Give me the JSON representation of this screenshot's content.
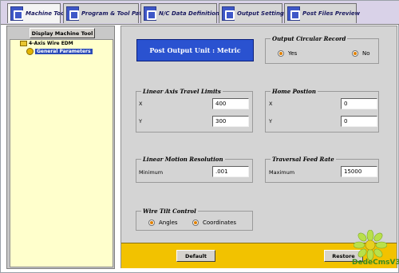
{
  "tabs": [
    {
      "label": "Machine Tool",
      "active": true
    },
    {
      "label": "Program & Tool Path",
      "active": false
    },
    {
      "label": "N/C Data Definitions",
      "active": false
    },
    {
      "label": "Output Settings",
      "active": false
    },
    {
      "label": "Post Files Preview",
      "active": false
    }
  ],
  "left": {
    "display_button": "Display Machine Tool",
    "tree": {
      "root": "4-Axis Wire EDM",
      "child": "General Parameters"
    }
  },
  "main": {
    "post_output_unit": "Post Output Unit : Metric",
    "circular": {
      "title": "Output Circular Record",
      "yes": "Yes",
      "no": "No",
      "selected": "Yes"
    },
    "linear_limits": {
      "title": "Linear Axis Travel Limits",
      "x_label": "X",
      "x_value": "400",
      "y_label": "Y",
      "y_value": "300"
    },
    "home": {
      "title": "Home Postion",
      "x_label": "X",
      "x_value": "0",
      "y_label": "Y",
      "y_value": "0"
    },
    "resolution": {
      "title": "Linear Motion Resolution",
      "label": "Minimum",
      "value": ".001"
    },
    "traversal": {
      "title": "Traversal Feed Rate",
      "label": "Maximum",
      "value": "15000"
    },
    "wire_tilt": {
      "title": "Wire Tilt Control",
      "angles": "Angles",
      "coordinates": "Coordinates",
      "selected": "Coordinates"
    },
    "buttons": {
      "default": "Default",
      "restore": "Restore"
    }
  },
  "watermark": "DedeCmsV3",
  "colors": {
    "tab_bar": "#d9d2e8",
    "post_unit_bg": "#2a52d0",
    "bottom_bar": "#f2c200",
    "radio_dot": "#e08000",
    "tree_bg": "#ffffcc"
  }
}
